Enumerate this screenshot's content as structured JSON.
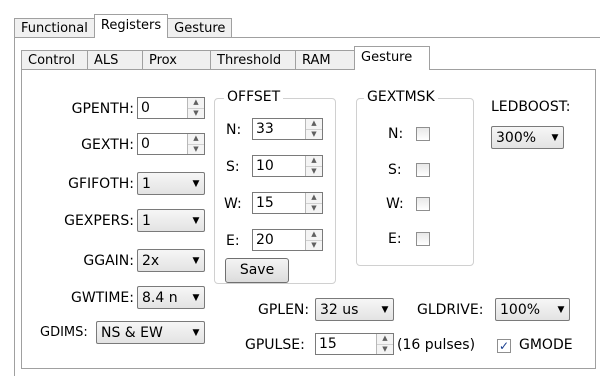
{
  "top_tabs": [
    "Functional",
    "Registers",
    "Gesture"
  ],
  "sub_tabs": [
    "Control",
    "ALS",
    "Prox",
    "Threshold",
    "RAM",
    "Gesture"
  ],
  "fields": {
    "gpenth": {
      "label": "GPENTH:",
      "value": "0"
    },
    "gexth": {
      "label": "GEXTH:",
      "value": "0"
    },
    "gfifoth": {
      "label": "GFIFOTH:",
      "value": "1"
    },
    "gexpers": {
      "label": "GEXPERS:",
      "value": "1"
    },
    "ggain": {
      "label": "GGAIN:",
      "value": "2x"
    },
    "gwtime": {
      "label": "GWTIME:",
      "value": "8.4 n"
    },
    "gdims": {
      "label": "GDIMS:",
      "value": "NS & EW"
    },
    "gplen": {
      "label": "GPLEN:",
      "value": "32 us"
    },
    "gldrive": {
      "label": "GLDRIVE:",
      "value": "100%"
    },
    "gpulse": {
      "label": "GPULSE:",
      "value": "15",
      "note": "(16 pulses)"
    },
    "gmode": {
      "label": "GMODE",
      "checked": true
    }
  },
  "offset": {
    "title": "OFFSET",
    "n": {
      "label": "N:",
      "value": "33"
    },
    "s": {
      "label": "S:",
      "value": "10"
    },
    "w": {
      "label": "W:",
      "value": "15"
    },
    "e": {
      "label": "E:",
      "value": "20"
    },
    "save_label": "Save"
  },
  "gextmsk": {
    "title": "GEXTMSK",
    "n": {
      "label": "N:",
      "checked": false
    },
    "s": {
      "label": "S:",
      "checked": false
    },
    "w": {
      "label": "W:",
      "checked": false
    },
    "e": {
      "label": "E:",
      "checked": false
    }
  },
  "ledboost": {
    "label": "LEDBOOST:",
    "value": "300%"
  }
}
